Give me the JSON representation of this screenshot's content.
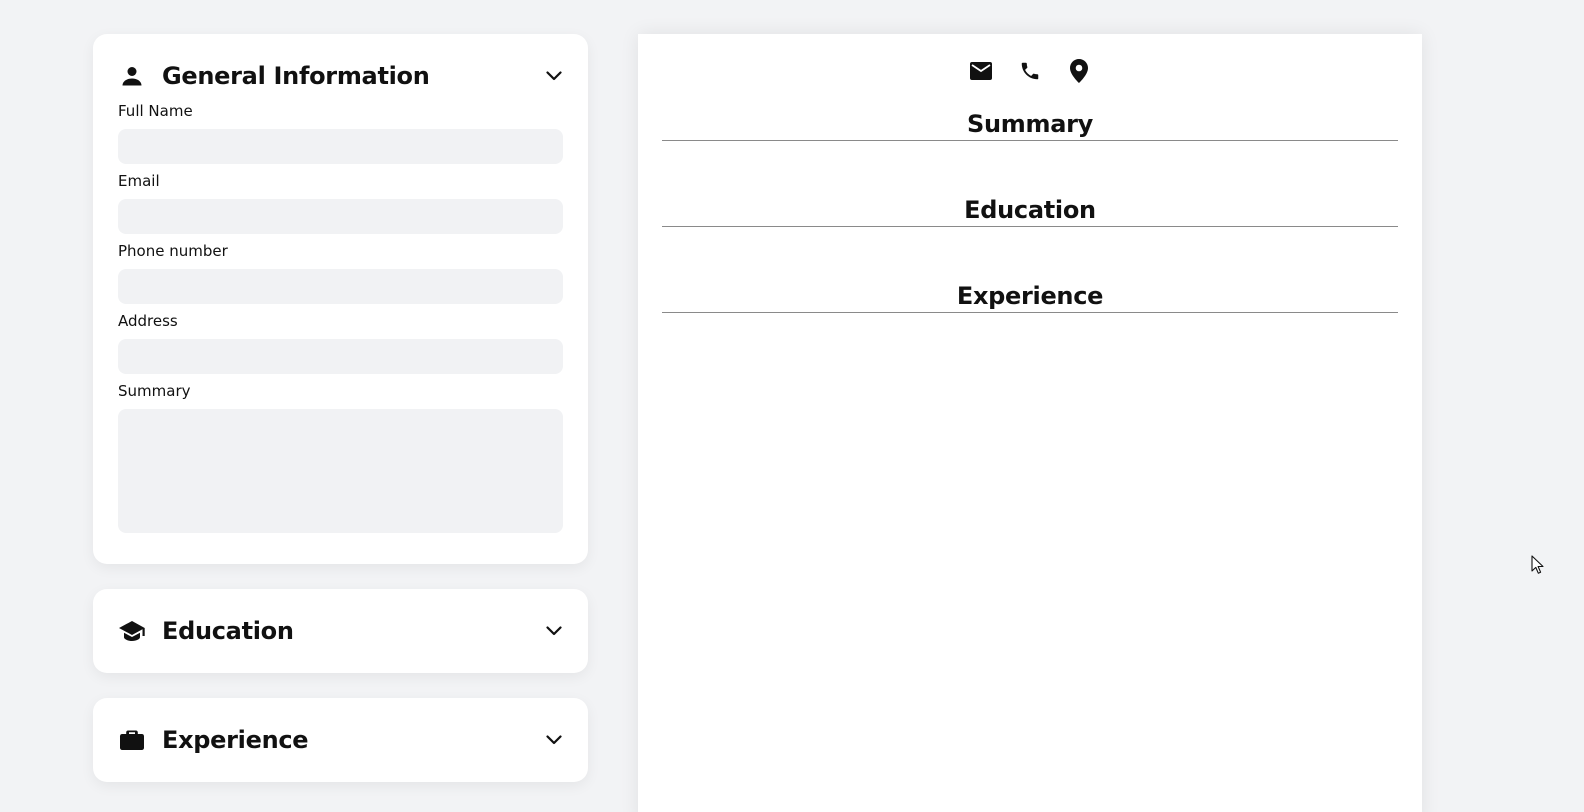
{
  "sidebar": {
    "general": {
      "title": "General Information",
      "icon": "person-icon",
      "fields": {
        "full_name": {
          "label": "Full Name",
          "value": ""
        },
        "email": {
          "label": "Email",
          "value": ""
        },
        "phone": {
          "label": "Phone number",
          "value": ""
        },
        "address": {
          "label": "Address",
          "value": ""
        },
        "summary": {
          "label": "Summary",
          "value": ""
        }
      }
    },
    "education": {
      "title": "Education",
      "icon": "graduation-cap-icon"
    },
    "experience": {
      "title": "Experience",
      "icon": "briefcase-icon"
    }
  },
  "preview": {
    "contact_icons": [
      "email-icon",
      "phone-icon",
      "location-pin-icon"
    ],
    "sections": {
      "summary": "Summary",
      "education": "Education",
      "experience": "Experience"
    }
  },
  "colors": {
    "background": "#f2f3f5",
    "card": "#ffffff",
    "input": "#f1f2f4",
    "text": "#111111",
    "divider": "#8a8a8a"
  }
}
